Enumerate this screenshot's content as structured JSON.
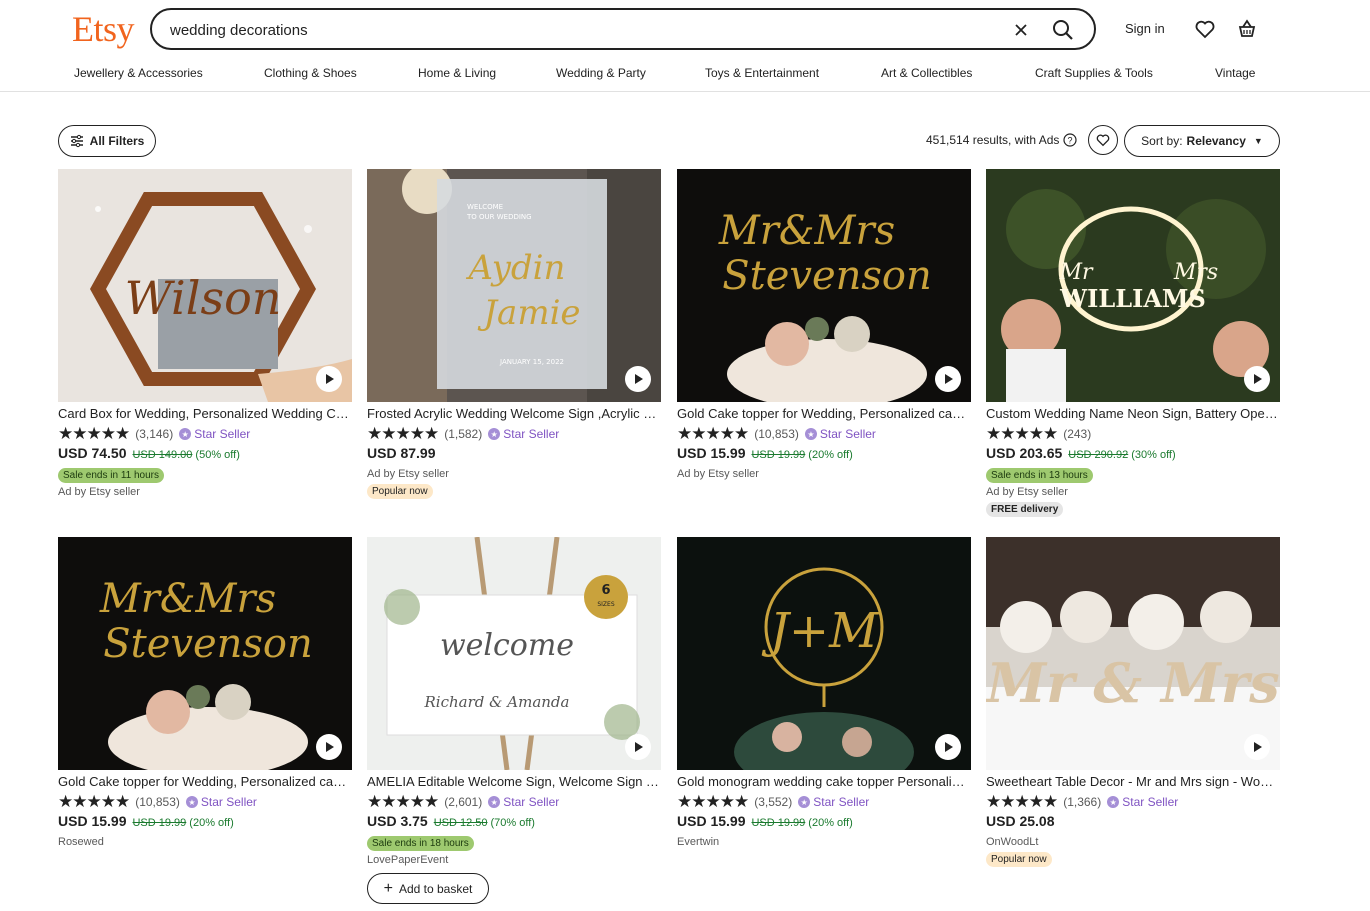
{
  "header": {
    "logo": "Etsy",
    "search_value": "wedding decorations",
    "sign_in": "Sign in"
  },
  "nav": [
    "Jewellery & Accessories",
    "Clothing & Shoes",
    "Home & Living",
    "Wedding & Party",
    "Toys & Entertainment",
    "Art & Collectibles",
    "Craft Supplies & Tools",
    "Vintage"
  ],
  "filters": {
    "all_filters": "All Filters",
    "results": "451,514 results, with Ads",
    "sort_prefix": "Sort by:",
    "sort_value": "Relevancy"
  },
  "products": [
    {
      "title": "Card Box for Wedding, Personalized Wedding Card Box",
      "rating_count": "(3,146)",
      "star_seller": "Star Seller",
      "price": "USD 74.50",
      "original_price": "USD 149.00",
      "discount": "(50% off)",
      "sale_badge": "Sale ends in 11 hours",
      "seller": "Ad by Etsy seller",
      "extra_badge": "",
      "image_text": "Wilson"
    },
    {
      "title": "Frosted Acrylic Wedding Welcome Sign ,Acrylic Sign",
      "rating_count": "(1,582)",
      "star_seller": "Star Seller",
      "price": "USD 87.99",
      "original_price": "",
      "discount": "",
      "sale_badge": "",
      "seller": "Ad by Etsy seller",
      "extra_badge": "Popular now",
      "image_text": "Aydin + Jamie"
    },
    {
      "title": "Gold Cake topper for Wedding, Personalized cake topper",
      "rating_count": "(10,853)",
      "star_seller": "Star Seller",
      "price": "USD 15.99",
      "original_price": "USD 19.99",
      "discount": "(20% off)",
      "sale_badge": "",
      "seller": "Ad by Etsy seller",
      "extra_badge": "",
      "image_text": "Mr&Mrs Stevenson"
    },
    {
      "title": "Custom Wedding Name Neon Sign, Battery Operated",
      "rating_count": "(243)",
      "star_seller": "",
      "price": "USD 203.65",
      "original_price": "USD 290.92",
      "discount": "(30% off)",
      "sale_badge": "Sale ends in 13 hours",
      "seller": "Ad by Etsy seller",
      "extra_badge": "FREE delivery",
      "image_text": "Mr & Mrs WILLIAMS"
    },
    {
      "title": "Gold Cake topper for Wedding, Personalized cake topper",
      "rating_count": "(10,853)",
      "star_seller": "Star Seller",
      "price": "USD 15.99",
      "original_price": "USD 19.99",
      "discount": "(20% off)",
      "sale_badge": "",
      "seller": "Rosewed",
      "extra_badge": "",
      "image_text": "Mr&Mrs Stevenson"
    },
    {
      "title": "AMELIA Editable Welcome Sign, Welcome Sign Template",
      "rating_count": "(2,601)",
      "star_seller": "Star Seller",
      "price": "USD 3.75",
      "original_price": "USD 12.50",
      "discount": "(70% off)",
      "sale_badge": "Sale ends in 18 hours",
      "seller": "LovePaperEvent",
      "extra_badge": "",
      "image_text": "welcome",
      "basket": "Add to basket"
    },
    {
      "title": "Gold monogram wedding cake topper Personalized",
      "rating_count": "(3,552)",
      "star_seller": "Star Seller",
      "price": "USD 15.99",
      "original_price": "USD 19.99",
      "discount": "(20% off)",
      "sale_badge": "",
      "seller": "Evertwin",
      "extra_badge": "",
      "image_text": "J+M"
    },
    {
      "title": "Sweetheart Table Decor - Mr and Mrs sign - Wooden",
      "rating_count": "(1,366)",
      "star_seller": "Star Seller",
      "price": "USD 25.08",
      "original_price": "",
      "discount": "",
      "sale_badge": "",
      "seller": "OnWoodLt",
      "extra_badge": "Popular now",
      "image_text": "Mr & Mrs"
    }
  ]
}
